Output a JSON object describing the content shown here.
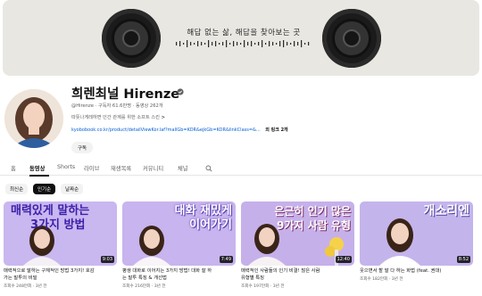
{
  "banner": {
    "tagline": "해답 없는 삶, 해답을 찾아보는 곳"
  },
  "channel": {
    "title": "희렌최널 Hirenze",
    "handle": "@Hirenze",
    "subscribers": "구독자 61.6만명",
    "video_count": "동영상 262개",
    "description": "따뜻나게레하면 인간 관계를 위한 소프트 스킨",
    "description_more_label": ">",
    "link_url": "kyobobook.co.kr/product/detailViewKor.laf?mallGb=KOR&ejkGb=KOR&linkClass=&...",
    "link_more_label": "외 링크 2개",
    "subscribe_label": "구독"
  },
  "tabs": [
    {
      "label": "홈",
      "active": false
    },
    {
      "label": "동영상",
      "active": true
    },
    {
      "label": "Shorts",
      "active": false
    },
    {
      "label": "라이브",
      "active": false
    },
    {
      "label": "재생목록",
      "active": false
    },
    {
      "label": "커뮤니티",
      "active": false
    },
    {
      "label": "채널",
      "active": false
    }
  ],
  "filters": [
    {
      "label": "최신순",
      "active": false
    },
    {
      "label": "인기순",
      "active": true
    },
    {
      "label": "날짜순",
      "active": false
    }
  ],
  "videos": [
    {
      "thumb_caption_1": "매력있게 말하는",
      "thumb_caption_2": "3가지 방법",
      "duration": "9:03",
      "title_1": "매력적으로 말하는 구체적인 방법 3가지! 호감",
      "title_2": "가는 말투의 비밀",
      "stats": "조회수 248만회 · 3년 전",
      "bg": "#c9b7f0",
      "caption_color": "#3b1fa8"
    },
    {
      "thumb_caption_1": "대화 재밌게",
      "thumb_caption_2": "이어가기",
      "duration": "7:49",
      "title_1": "평생 대화로 이어지는 3가지 방법! 대화 잘 하",
      "title_2": "는 말투 특징 & 개선법",
      "stats": "조회수 216만회 · 3년 전",
      "bg": "#c8b4ee",
      "caption_color": "#ffffff"
    },
    {
      "thumb_caption_1": "은근히 인기 많은",
      "thumb_caption_2": "9가지 사람 유형",
      "duration": "12:40",
      "title_1": "매력적인 사람들의 인기 비결! 많은 사람",
      "title_2": "유형별 특징",
      "stats": "조회수 197만회 · 3년 전",
      "bg": "#c6b0ea",
      "caption_color": "#ffffff"
    },
    {
      "thumb_caption_1": "개소리엔",
      "thumb_caption_2": "",
      "duration": "8:52",
      "title_1": "웃으면서 할 말 다 하는 화법 (feat. 권대)",
      "title_2": "",
      "stats": "조회수 182만회 · 3년 전",
      "bg": "#c4b4ec",
      "caption_color": "#ffffff"
    }
  ]
}
